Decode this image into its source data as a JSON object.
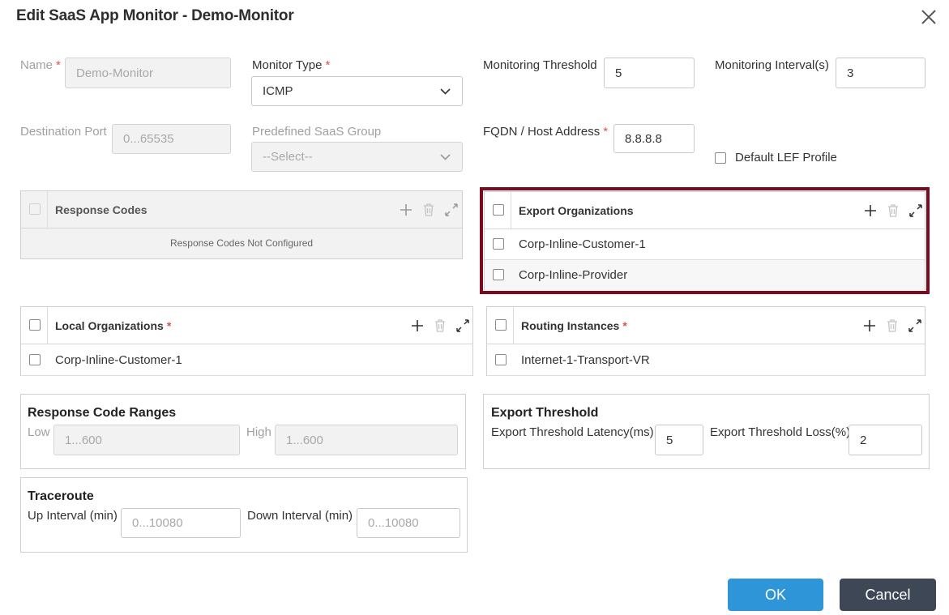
{
  "dialog": {
    "title": "Edit SaaS App Monitor - Demo-Monitor"
  },
  "form": {
    "name": {
      "label": "Name",
      "required": "*",
      "value": "Demo-Monitor"
    },
    "monitor_type": {
      "label": "Monitor Type",
      "required": "*",
      "value": "ICMP"
    },
    "monitoring_threshold": {
      "label": "Monitoring Threshold",
      "value": "5"
    },
    "monitoring_interval": {
      "label": "Monitoring Interval(s)",
      "value": "3"
    },
    "destination_port": {
      "label": "Destination Port",
      "placeholder": "0...65535"
    },
    "predefined_saas_group": {
      "label": "Predefined SaaS Group",
      "value": "--Select--"
    },
    "fqdn": {
      "label": "FQDN / Host Address",
      "required": "*",
      "value": "8.8.8.8"
    },
    "default_lef_profile": {
      "label": "Default LEF Profile",
      "checked": false
    }
  },
  "response_codes": {
    "header": "Response Codes",
    "empty_text": "Response Codes Not Configured"
  },
  "export_organizations": {
    "header": "Export Organizations",
    "rows": [
      "Corp-Inline-Customer-1",
      "Corp-Inline-Provider"
    ],
    "highlight_color": "#7b0a1f"
  },
  "local_organizations": {
    "header": "Local Organizations",
    "required": "*",
    "rows": [
      "Corp-Inline-Customer-1"
    ]
  },
  "routing_instances": {
    "header": "Routing Instances",
    "required": "*",
    "rows": [
      "Internet-1-Transport-VR"
    ]
  },
  "response_code_ranges": {
    "title": "Response Code Ranges",
    "low_label": "Low",
    "low_placeholder": "1...600",
    "high_label": "High",
    "high_placeholder": "1...600"
  },
  "export_threshold": {
    "title": "Export Threshold",
    "latency_label": "Export Threshold Latency(ms)",
    "latency_value": "5",
    "loss_label": "Export Threshold Loss(%)",
    "loss_value": "2"
  },
  "traceroute": {
    "title": "Traceroute",
    "up_label": "Up Interval (min)",
    "up_placeholder": "0...10080",
    "down_label": "Down Interval (min)",
    "down_placeholder": "0...10080"
  },
  "buttons": {
    "ok": "OK",
    "cancel": "Cancel",
    "ok_color": "#2e95d8",
    "cancel_color": "#3e4756"
  },
  "icons": [
    "close-icon",
    "chevron-down-icon",
    "plus-icon",
    "trash-icon",
    "expand-icon"
  ]
}
